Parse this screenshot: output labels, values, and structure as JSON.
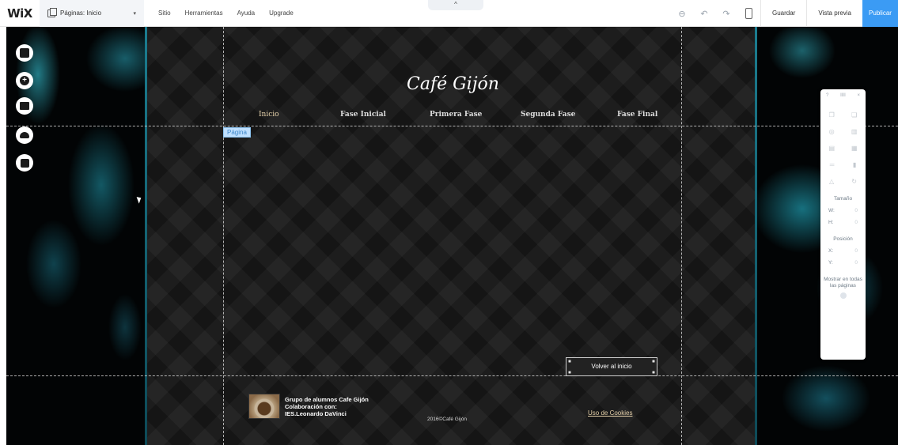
{
  "topbar": {
    "logo": "WiX",
    "pages_dropdown": "Páginas: Inicio",
    "menu": [
      "Sitio",
      "Herramientas",
      "Ayuda",
      "Upgrade"
    ],
    "expand_arrow": "^",
    "zoom_icon": "⊖",
    "undo_icon": "↶",
    "redo_icon": "↷",
    "save": "Guardar",
    "preview": "Vista previa",
    "publish": "Publicar"
  },
  "site": {
    "title": "Café Gijón",
    "nav": [
      "Inicio",
      "Fase Inicial",
      "Primera Fase",
      "Segunda Fase",
      "Fase Final"
    ],
    "page_label": "Página",
    "back_button": "Volver al inicio",
    "footer": {
      "line1": "Grupo de alumnos Cafe Gijón",
      "line2": "Colaboración con:",
      "line3": "IES.Leonardo DaVinci",
      "copyright": "2016©Café Gijón",
      "cookies": "Uso de Cookies"
    }
  },
  "inspector": {
    "help": "?",
    "grip": "IIII",
    "close": "×",
    "size_label": "Tamaño",
    "w_label": "W:",
    "w_value": "0",
    "h_label": "H:",
    "h_value": "0",
    "pos_label": "Posición",
    "x_label": "X:",
    "x_value": "0",
    "y_label": "Y:",
    "y_value": "0",
    "show_all": "Mostrar en todas las páginas"
  }
}
